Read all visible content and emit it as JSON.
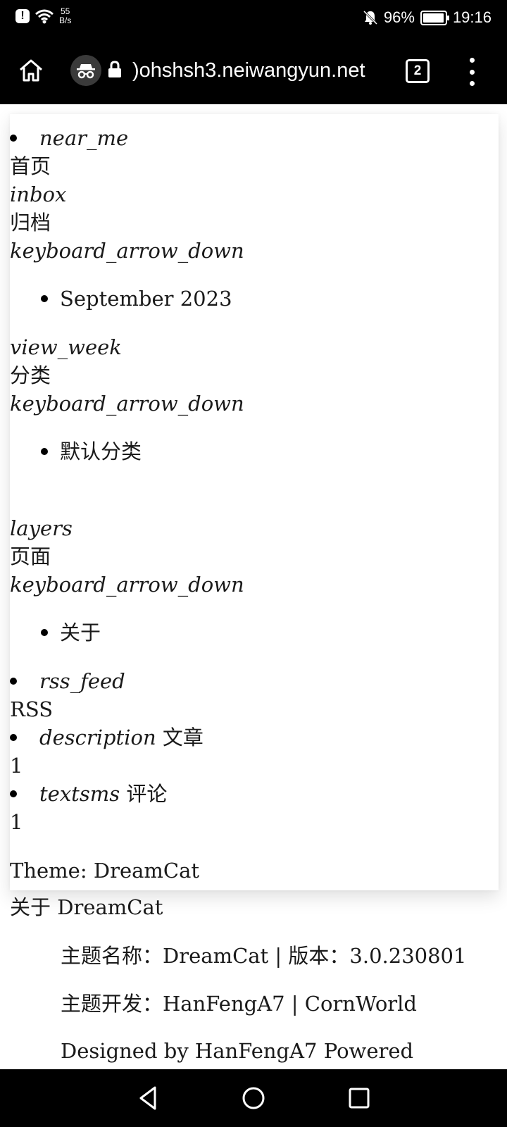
{
  "status_bar": {
    "speed_value": "55",
    "speed_unit": "B/s",
    "battery_percent": "96%",
    "battery_level": 0.96,
    "time": "19:16",
    "icons": [
      "alert-icon",
      "wifi-icon",
      "bell-off-icon",
      "battery-icon"
    ]
  },
  "browser": {
    "url": ")ohshsh3.neiwangyun.net",
    "tab_count": "2"
  },
  "menu": {
    "near_me": "near_me",
    "home": "首页",
    "inbox": "inbox",
    "archive": "归档",
    "arrow1": "keyboard_arrow_down",
    "archive_item": "September 2023",
    "view_week": "view_week",
    "category": "分类",
    "arrow2": "keyboard_arrow_down",
    "category_item": "默认分类",
    "layers": "layers",
    "pages": "页面",
    "arrow3": "keyboard_arrow_down",
    "pages_item": "关于",
    "rss_feed": "rss_feed",
    "rss": "RSS",
    "description": "description",
    "articles": "文章",
    "articles_count": "1",
    "textsms": "textsms",
    "comments": "评论",
    "comments_count": "1",
    "theme": "Theme: DreamCat"
  },
  "about": {
    "title": "关于 DreamCat",
    "line1": "主题名称：DreamCat | 版本：3.0.230801",
    "line2": "主题开发：HanFengA7 | CornWorld",
    "line3": "Designed by HanFengA7 Powered"
  }
}
